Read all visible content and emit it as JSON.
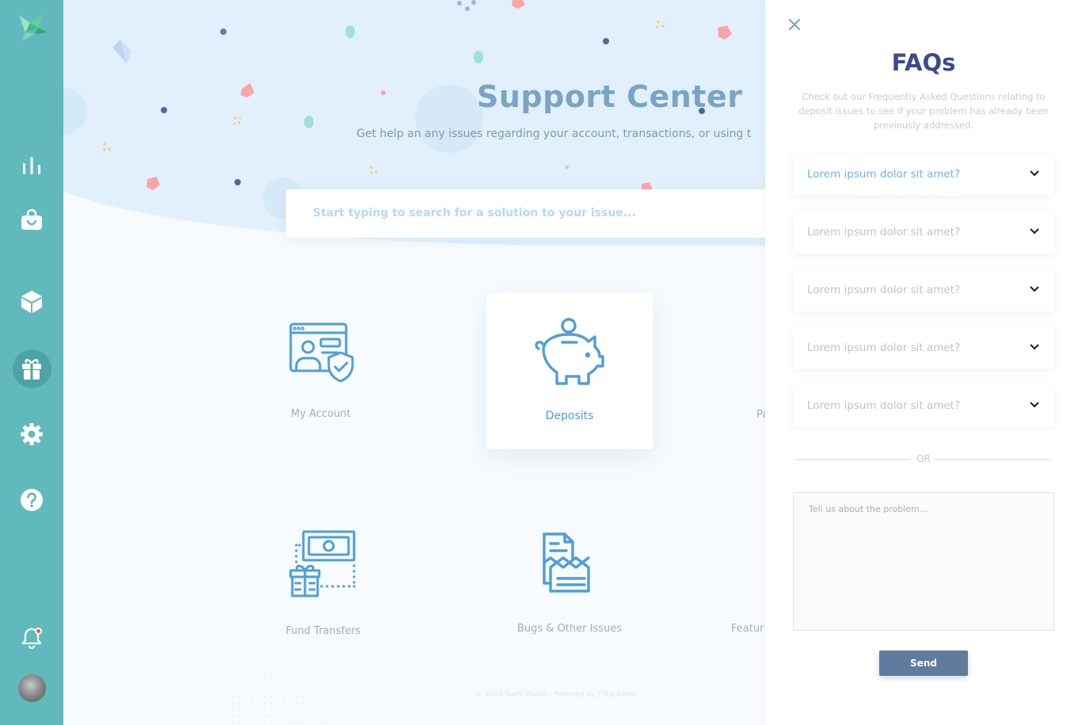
{
  "sidebar": {
    "logo": "bird-logo-icon",
    "items": [
      {
        "icon": "bar-chart-icon"
      },
      {
        "icon": "shopping-bag-icon"
      },
      {
        "icon": "cube-icon"
      },
      {
        "icon": "gift-icon",
        "active": true
      },
      {
        "icon": "gear-icon"
      },
      {
        "icon": "help-icon"
      }
    ],
    "notifications_icon": "bell-icon",
    "avatar": "user-avatar"
  },
  "main": {
    "title": "Support Center",
    "subtitle": "Get help an any issues regarding your account, transactions, or using t",
    "search": {
      "placeholder": "Start typing to search for a solution to your issue..."
    },
    "categories": [
      {
        "label": "My Account",
        "icon": "account-security-icon"
      },
      {
        "label": "Deposits",
        "icon": "piggy-bank-icon",
        "active": true
      },
      {
        "label": "Pa",
        "icon": ""
      },
      {
        "label": "Fund Transfers",
        "icon": "fund-transfer-icon"
      },
      {
        "label": "Bugs & Other Issues",
        "icon": "bug-report-icon"
      },
      {
        "label": "Featur",
        "icon": ""
      }
    ],
    "footer": "© 2018 Swift Wallet - Powered by FStackDev"
  },
  "panel": {
    "close_icon": "close-icon",
    "title": "FAQs",
    "description": "Check out our Frequently Asked Questions relating to deposit issues to see if your problem has already been previously addressed.",
    "faqs": [
      "Lorem ipsum dolor sit amet?",
      "Lorem ipsum dolor sit amet?",
      "Lorem ipsum dolor sit amet?",
      "Lorem ipsum dolor sit amet?",
      "Lorem ipsum dolor sit amet?"
    ],
    "or_text": "OR",
    "message_placeholder": "Tell us about the problem...",
    "send_label": "Send"
  },
  "colors": {
    "sidebar": "#62b9bd",
    "accent": "#4e9ed8",
    "panel_title": "#3d4a8c",
    "send_button": "#607b9e"
  }
}
